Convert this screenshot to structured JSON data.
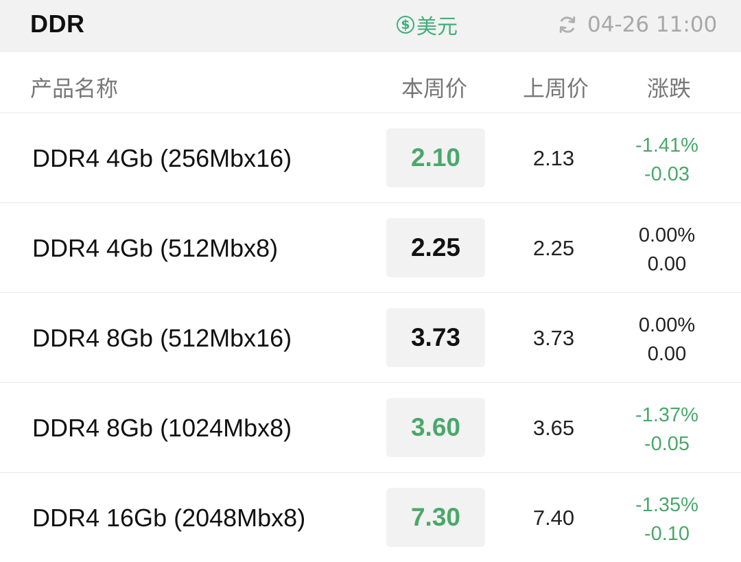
{
  "header": {
    "title": "DDR",
    "currency_symbol": "$",
    "currency_label": "美元",
    "refresh_icon": "refresh-icon",
    "updated_time": "04-26 11:00"
  },
  "columns": {
    "name": "产品名称",
    "this_week": "本周价",
    "last_week": "上周价",
    "change": "涨跌"
  },
  "colors": {
    "down": "#4aa86a",
    "accent": "#3fae7a"
  },
  "rows": [
    {
      "name": "DDR4 4Gb (256Mbx16)",
      "this_week": "2.10",
      "last_week": "2.13",
      "change_pct": "-1.41%",
      "change_abs": "-0.03",
      "trend": "down"
    },
    {
      "name": "DDR4 4Gb (512Mbx8)",
      "this_week": "2.25",
      "last_week": "2.25",
      "change_pct": "0.00%",
      "change_abs": "0.00",
      "trend": "flat"
    },
    {
      "name": "DDR4 8Gb (512Mbx16)",
      "this_week": "3.73",
      "last_week": "3.73",
      "change_pct": "0.00%",
      "change_abs": "0.00",
      "trend": "flat"
    },
    {
      "name": "DDR4 8Gb (1024Mbx8)",
      "this_week": "3.60",
      "last_week": "3.65",
      "change_pct": "-1.37%",
      "change_abs": "-0.05",
      "trend": "down"
    },
    {
      "name": "DDR4 16Gb (2048Mbx8)",
      "this_week": "7.30",
      "last_week": "7.40",
      "change_pct": "-1.35%",
      "change_abs": "-0.10",
      "trend": "down"
    }
  ]
}
